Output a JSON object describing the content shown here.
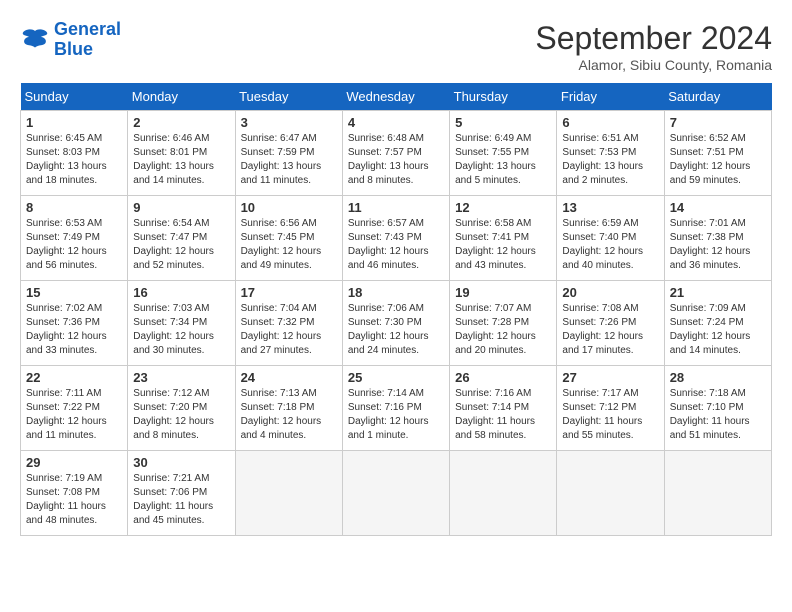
{
  "header": {
    "logo_line1": "General",
    "logo_line2": "Blue",
    "month_title": "September 2024",
    "location": "Alamor, Sibiu County, Romania"
  },
  "weekdays": [
    "Sunday",
    "Monday",
    "Tuesday",
    "Wednesday",
    "Thursday",
    "Friday",
    "Saturday"
  ],
  "days": [
    {
      "num": "",
      "info": ""
    },
    {
      "num": "",
      "info": ""
    },
    {
      "num": "",
      "info": ""
    },
    {
      "num": "",
      "info": ""
    },
    {
      "num": "",
      "info": ""
    },
    {
      "num": "",
      "info": ""
    },
    {
      "num": "",
      "info": ""
    },
    {
      "num": "1",
      "info": "Sunrise: 6:45 AM\nSunset: 8:03 PM\nDaylight: 13 hours\nand 18 minutes."
    },
    {
      "num": "2",
      "info": "Sunrise: 6:46 AM\nSunset: 8:01 PM\nDaylight: 13 hours\nand 14 minutes."
    },
    {
      "num": "3",
      "info": "Sunrise: 6:47 AM\nSunset: 7:59 PM\nDaylight: 13 hours\nand 11 minutes."
    },
    {
      "num": "4",
      "info": "Sunrise: 6:48 AM\nSunset: 7:57 PM\nDaylight: 13 hours\nand 8 minutes."
    },
    {
      "num": "5",
      "info": "Sunrise: 6:49 AM\nSunset: 7:55 PM\nDaylight: 13 hours\nand 5 minutes."
    },
    {
      "num": "6",
      "info": "Sunrise: 6:51 AM\nSunset: 7:53 PM\nDaylight: 13 hours\nand 2 minutes."
    },
    {
      "num": "7",
      "info": "Sunrise: 6:52 AM\nSunset: 7:51 PM\nDaylight: 12 hours\nand 59 minutes."
    },
    {
      "num": "8",
      "info": "Sunrise: 6:53 AM\nSunset: 7:49 PM\nDaylight: 12 hours\nand 56 minutes."
    },
    {
      "num": "9",
      "info": "Sunrise: 6:54 AM\nSunset: 7:47 PM\nDaylight: 12 hours\nand 52 minutes."
    },
    {
      "num": "10",
      "info": "Sunrise: 6:56 AM\nSunset: 7:45 PM\nDaylight: 12 hours\nand 49 minutes."
    },
    {
      "num": "11",
      "info": "Sunrise: 6:57 AM\nSunset: 7:43 PM\nDaylight: 12 hours\nand 46 minutes."
    },
    {
      "num": "12",
      "info": "Sunrise: 6:58 AM\nSunset: 7:41 PM\nDaylight: 12 hours\nand 43 minutes."
    },
    {
      "num": "13",
      "info": "Sunrise: 6:59 AM\nSunset: 7:40 PM\nDaylight: 12 hours\nand 40 minutes."
    },
    {
      "num": "14",
      "info": "Sunrise: 7:01 AM\nSunset: 7:38 PM\nDaylight: 12 hours\nand 36 minutes."
    },
    {
      "num": "15",
      "info": "Sunrise: 7:02 AM\nSunset: 7:36 PM\nDaylight: 12 hours\nand 33 minutes."
    },
    {
      "num": "16",
      "info": "Sunrise: 7:03 AM\nSunset: 7:34 PM\nDaylight: 12 hours\nand 30 minutes."
    },
    {
      "num": "17",
      "info": "Sunrise: 7:04 AM\nSunset: 7:32 PM\nDaylight: 12 hours\nand 27 minutes."
    },
    {
      "num": "18",
      "info": "Sunrise: 7:06 AM\nSunset: 7:30 PM\nDaylight: 12 hours\nand 24 minutes."
    },
    {
      "num": "19",
      "info": "Sunrise: 7:07 AM\nSunset: 7:28 PM\nDaylight: 12 hours\nand 20 minutes."
    },
    {
      "num": "20",
      "info": "Sunrise: 7:08 AM\nSunset: 7:26 PM\nDaylight: 12 hours\nand 17 minutes."
    },
    {
      "num": "21",
      "info": "Sunrise: 7:09 AM\nSunset: 7:24 PM\nDaylight: 12 hours\nand 14 minutes."
    },
    {
      "num": "22",
      "info": "Sunrise: 7:11 AM\nSunset: 7:22 PM\nDaylight: 12 hours\nand 11 minutes."
    },
    {
      "num": "23",
      "info": "Sunrise: 7:12 AM\nSunset: 7:20 PM\nDaylight: 12 hours\nand 8 minutes."
    },
    {
      "num": "24",
      "info": "Sunrise: 7:13 AM\nSunset: 7:18 PM\nDaylight: 12 hours\nand 4 minutes."
    },
    {
      "num": "25",
      "info": "Sunrise: 7:14 AM\nSunset: 7:16 PM\nDaylight: 12 hours\nand 1 minute."
    },
    {
      "num": "26",
      "info": "Sunrise: 7:16 AM\nSunset: 7:14 PM\nDaylight: 11 hours\nand 58 minutes."
    },
    {
      "num": "27",
      "info": "Sunrise: 7:17 AM\nSunset: 7:12 PM\nDaylight: 11 hours\nand 55 minutes."
    },
    {
      "num": "28",
      "info": "Sunrise: 7:18 AM\nSunset: 7:10 PM\nDaylight: 11 hours\nand 51 minutes."
    },
    {
      "num": "29",
      "info": "Sunrise: 7:19 AM\nSunset: 7:08 PM\nDaylight: 11 hours\nand 48 minutes."
    },
    {
      "num": "30",
      "info": "Sunrise: 7:21 AM\nSunset: 7:06 PM\nDaylight: 11 hours\nand 45 minutes."
    },
    {
      "num": "",
      "info": ""
    },
    {
      "num": "",
      "info": ""
    },
    {
      "num": "",
      "info": ""
    },
    {
      "num": "",
      "info": ""
    },
    {
      "num": "",
      "info": ""
    }
  ]
}
